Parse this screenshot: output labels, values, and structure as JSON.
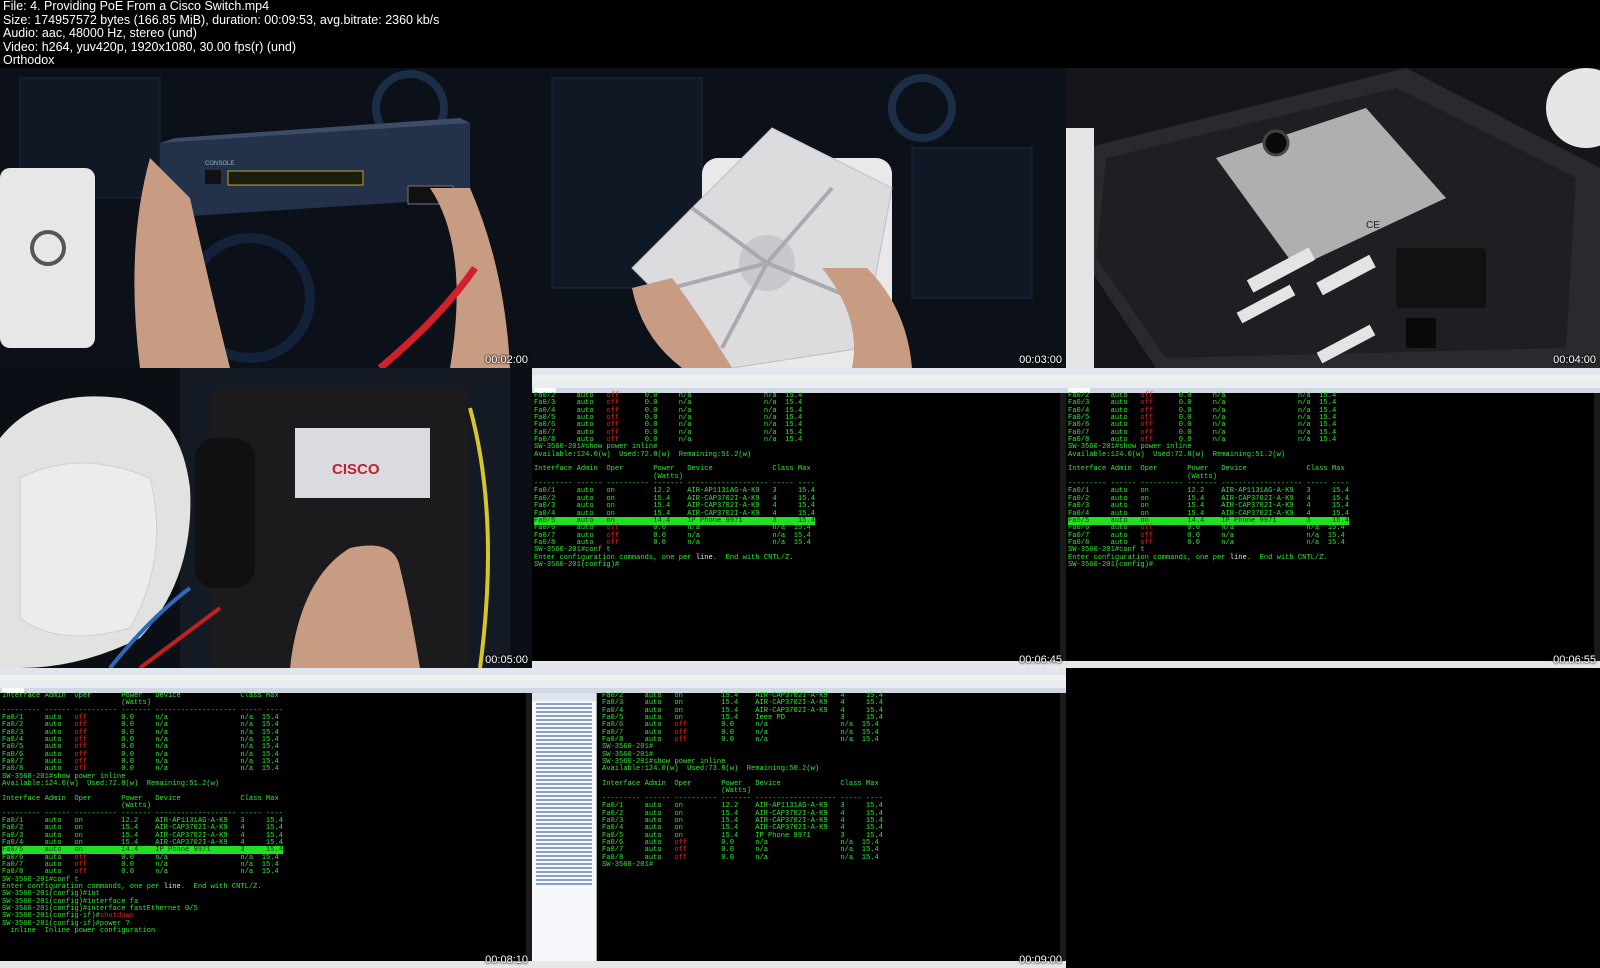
{
  "header": {
    "line1": "File: 4. Providing PoE From a Cisco Switch.mp4",
    "line2": "Size: 174957572 bytes (166.85 MiB), duration: 00:09:53, avg.bitrate: 2360 kb/s",
    "line3": "Audio: aac, 48000 Hz, stereo (und)",
    "line4": "Video: h264, yuv420p, 1920x1080, 30.00 fps(r) (und)",
    "line5": "Orthodox"
  },
  "thumbnails": [
    {
      "timestamp": "00:02:00",
      "kind": "photo",
      "brand_text": "CONSOLE"
    },
    {
      "timestamp": "00:03:00",
      "kind": "photo"
    },
    {
      "timestamp": "00:04:00",
      "kind": "photo",
      "brand_text": "CE"
    },
    {
      "timestamp": "00:05:00",
      "kind": "photo",
      "brand_text": "CISCO"
    },
    {
      "timestamp": "00:06:45",
      "kind": "terminal"
    },
    {
      "timestamp": "00:06:55",
      "kind": "terminal"
    },
    {
      "timestamp": "00:08:10",
      "kind": "terminal"
    },
    {
      "timestamp": "00:09:00",
      "kind": "terminal"
    }
  ],
  "colors": {
    "terminal_green": "#2ee82e",
    "terminal_red": "#e02020",
    "highlight": "#21e021"
  },
  "terminal_a": "Fa0/2     auto   off      0.0     n/a                 n/a  15.4\nFa0/3     auto   off      0.0     n/a                 n/a  15.4\nFa0/4     auto   off      0.0     n/a                 n/a  15.4\nFa0/5     auto   off      0.0     n/a                 n/a  15.4\nFa0/6     auto   off      0.0     n/a                 n/a  15.4\nFa0/7     auto   off      0.0     n/a                 n/a  15.4\nFa0/8     auto   off      0.0     n/a                 n/a  15.4\nSW-3560-201#show power inline\nAvailable:124.0(w)  Used:72.8(w)  Remaining:51.2(w)\n\nInterface Admin  Oper       Power   Device              Class Max\n                            (Watts)\n--------- ------ ---------- ------- ------------------- ----- ----\nFa0/1     auto   on         12.2    AIR-AP1131AG-A-K9   3     15.4\nFa0/2     auto   on         15.4    AIR-CAP3702I-A-K9   4     15.4\nFa0/3     auto   on         15.4    AIR-CAP3702I-A-K9   4     15.4\nFa0/4     auto   on         15.4    AIR-CAP3702I-A-K9   4     15.4\nFa0/5     auto   on         14.4    IP Phone 9971       3     15.4\nFa0/6     auto   off        0.0     n/a                 n/a  15.4\nFa0/7     auto   off        0.0     n/a                 n/a  15.4\nFa0/8     auto   off        0.0     n/a                 n/a  15.4\nSW-3560-201#conf t\nEnter configuration commands, one per line.  End with CNTL/Z.\nSW-3560-201(config)#",
  "terminal_c": "Interface Admin  Oper       Power   Device              Class Max\n                            (Watts)\n--------- ------ ---------- ------- ------------------- ----- ----\nFa0/1     auto   off        0.0     n/a                 n/a  15.4\nFa0/2     auto   off        0.0     n/a                 n/a  15.4\nFa0/3     auto   off        0.0     n/a                 n/a  15.4\nFa0/4     auto   off        0.0     n/a                 n/a  15.4\nFa0/5     auto   off        0.0     n/a                 n/a  15.4\nFa0/6     auto   off        0.0     n/a                 n/a  15.4\nFa0/7     auto   off        0.0     n/a                 n/a  15.4\nFa0/8     auto   off        0.0     n/a                 n/a  15.4\nSW-3560-201#show power inline\nAvailable:124.0(w)  Used:72.8(w)  Remaining:51.2(w)\n\nInterface Admin  Oper       Power   Device              Class Max\n                            (Watts)\n--------- ------ ---------- ------- ------------------- ----- ----\nFa0/1     auto   on         12.2    AIR-AP1131AG-A-K9   3     15.4\nFa0/2     auto   on         15.4    AIR-CAP3702I-A-K9   4     15.4\nFa0/3     auto   on         15.4    AIR-CAP3702I-A-K9   4     15.4\nFa0/4     auto   on         15.4    AIR-CAP3702I-A-K9   4     15.4\nFa0/5     auto   on         14.4    IP Phone 9971       3     15.4\nFa0/6     auto   off        0.0     n/a                 n/a  15.4\nFa0/7     auto   off        0.0     n/a                 n/a  15.4\nFa0/8     auto   off        0.0     n/a                 n/a  15.4\nSW-3560-201#conf t\nEnter configuration commands, one per line.  End with CNTL/Z.\nSW-3560-201(config)#int\nSW-3560-201(config)#interface fa\nSW-3560-201(config)#interface fastEthernet 0/5\nSW-3560-201(config-if)#shutdown\nSW-3560-201(config-if)#power ?\n  inline  Inline power configuration",
  "terminal_d": "Fa0/2     auto   on         15.4    AIR-CAP3702I-A-K9   4     15.4\nFa0/3     auto   on         15.4    AIR-CAP3702I-A-K9   4     15.4\nFa0/4     auto   on         15.4    AIR-CAP3702I-A-K9   4     15.4\nFa0/5     auto   on         15.4    Ieee PD             3     15.4\nFa0/6     auto   off        0.0     n/a                 n/a  15.4\nFa0/7     auto   off        0.0     n/a                 n/a  15.4\nFa0/8     auto   off        0.0     n/a                 n/a  15.4\nSW-3560-201#\nSW-3560-201#\nSW-3560-201#show power inline\nAvailable:124.0(w)  Used:73.8(w)  Remaining:50.2(w)\n\nInterface Admin  Oper       Power   Device              Class Max\n                            (Watts)\n--------- ------ ---------- ------- ------------------- ----- ----\nFa0/1     auto   on         12.2    AIR-AP1131AG-A-K9   3     15.4\nFa0/2     auto   on         15.4    AIR-CAP3702I-A-K9   4     15.4\nFa0/3     auto   on         15.4    AIR-CAP3702I-A-K9   4     15.4\nFa0/4     auto   on         15.4    AIR-CAP3702I-A-K9   4     15.4\nFa0/5     auto   on         15.4    IP Phone 9971       3     15.4\nFa0/6     auto   off        0.0     n/a                 n/a  15.4\nFa0/7     auto   off        0.0     n/a                 n/a  15.4\nFa0/8     auto   off        0.0     n/a                 n/a  15.4\nSW-3560-201#"
}
